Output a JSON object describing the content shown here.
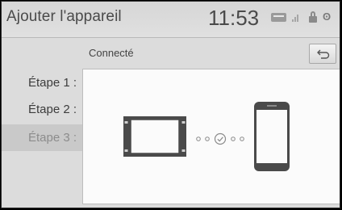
{
  "header": {
    "title": "Ajouter l'appareil",
    "time": "11:53",
    "status_icons": [
      "dcm-icon",
      "signal-icon",
      "lock-icon",
      "bluetooth-icon"
    ],
    "dcm_label": "DCM",
    "bluetooth_glyph": "ʘ"
  },
  "subheader": {
    "status_label": "Connecté"
  },
  "steps": [
    {
      "label": "Étape 1 :"
    },
    {
      "label": "Étape 2 :"
    },
    {
      "label": "Étape 3 :"
    }
  ],
  "diagram": {
    "left_device": "car-head-unit-icon",
    "right_device": "smartphone-icon",
    "link_state": "connected-check-icon"
  },
  "colors": {
    "background": "#dcdcdc",
    "panel": "#fbfbfb",
    "text": "#4a4a4a",
    "active_step_bg": "#c9c9c9"
  }
}
